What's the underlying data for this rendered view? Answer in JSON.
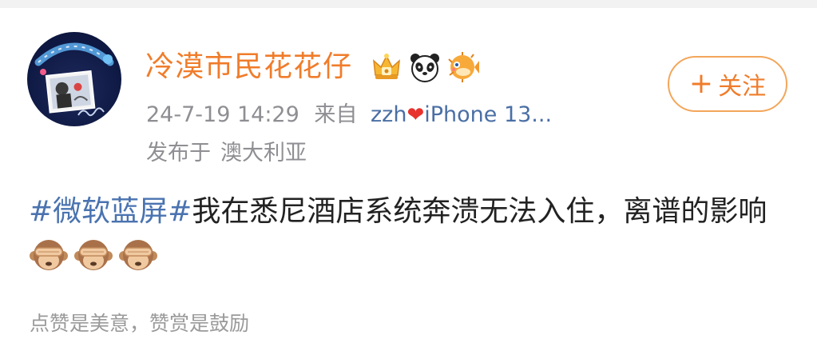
{
  "post": {
    "user": {
      "name": "冷漠市民花花仔",
      "avatar_icon": "avatar-image",
      "badges": [
        "crown-badge-icon",
        "panda-badge-icon",
        "pufferfish-badge-icon"
      ]
    },
    "timestamp": "24-7-19 14:29",
    "source_prefix": "来自",
    "source_user": "zzh",
    "source_heart": "❤",
    "source_device": "iPhone 13...",
    "location_prefix": "发布于",
    "location": "澳大利亚",
    "follow_button": {
      "plus": "+",
      "label": "关注"
    },
    "hashtag": "#微软蓝屏#",
    "text": "我在悉尼酒店系统奔溃无法入住，离谱的影响",
    "emojis": [
      "see-no-evil-monkey-icon",
      "see-no-evil-monkey-icon",
      "see-no-evil-monkey-icon"
    ],
    "footer": "点赞是美意，赞赏是鼓励"
  },
  "colors": {
    "username": "#f07c2a",
    "hashtag": "#4a73b0",
    "meta": "#8e8e93",
    "follow_border": "#f3a65b",
    "heart": "#e8322e"
  }
}
